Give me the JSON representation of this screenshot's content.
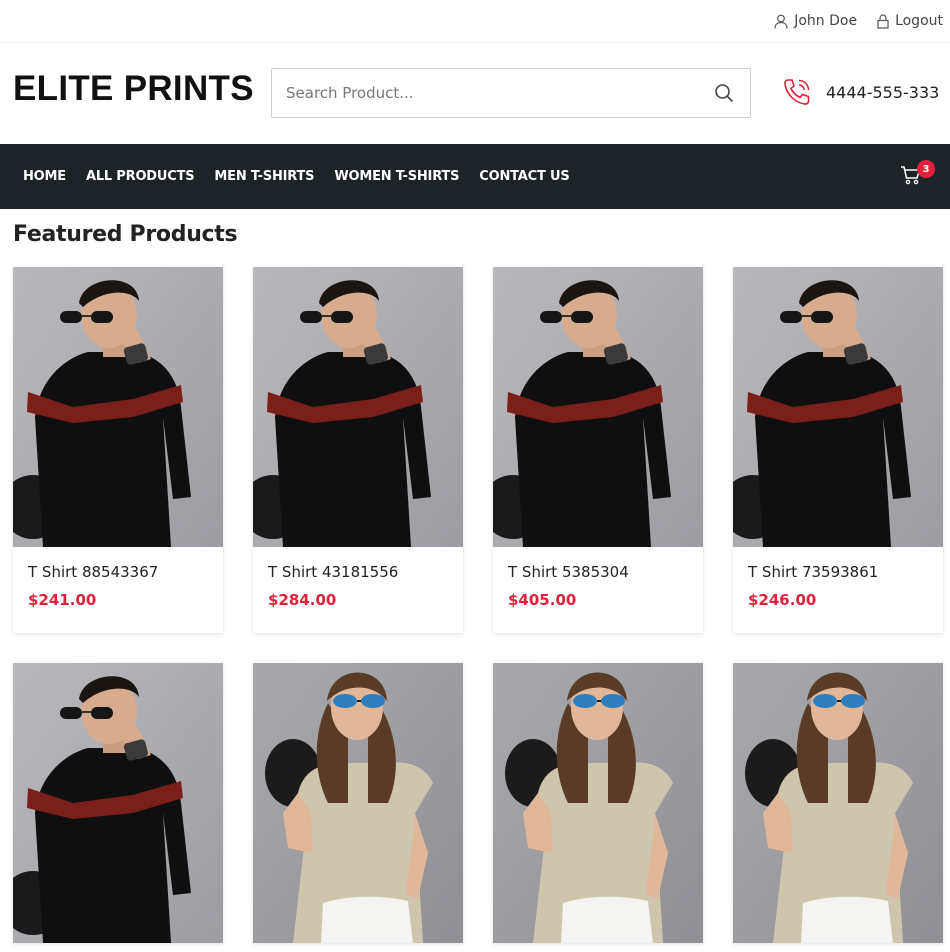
{
  "topbar": {
    "user_label": "John Doe",
    "logout_label": "Logout"
  },
  "header": {
    "logo": "ELITE PRINTS",
    "search_placeholder": "Search Product...",
    "phone": "4444-555-333"
  },
  "nav": {
    "items": [
      "HOME",
      "ALL PRODUCTS",
      "MEN T-SHIRTS",
      "WOMEN T-SHIRTS",
      "CONTACT US"
    ],
    "cart_count": "3"
  },
  "section_title": "Featured Products",
  "products": [
    {
      "name": "T Shirt 88543367",
      "price": "$241.00",
      "image": "man-black-striped-tshirt"
    },
    {
      "name": "T Shirt 43181556",
      "price": "$284.00",
      "image": "man-black-striped-tshirt"
    },
    {
      "name": "T Shirt 5385304",
      "price": "$405.00",
      "image": "man-black-striped-tshirt"
    },
    {
      "name": "T Shirt 73593861",
      "price": "$246.00",
      "image": "man-black-striped-tshirt"
    },
    {
      "name": "",
      "price": "",
      "image": "man-black-striped-tshirt"
    },
    {
      "name": "",
      "price": "",
      "image": "woman-beige-tshirt"
    },
    {
      "name": "",
      "price": "",
      "image": "woman-beige-tshirt"
    },
    {
      "name": "",
      "price": "",
      "image": "woman-beige-tshirt"
    }
  ],
  "colors": {
    "nav_bg": "#1d2428",
    "price": "#e3203b",
    "phone_icon": "#e3203b"
  }
}
